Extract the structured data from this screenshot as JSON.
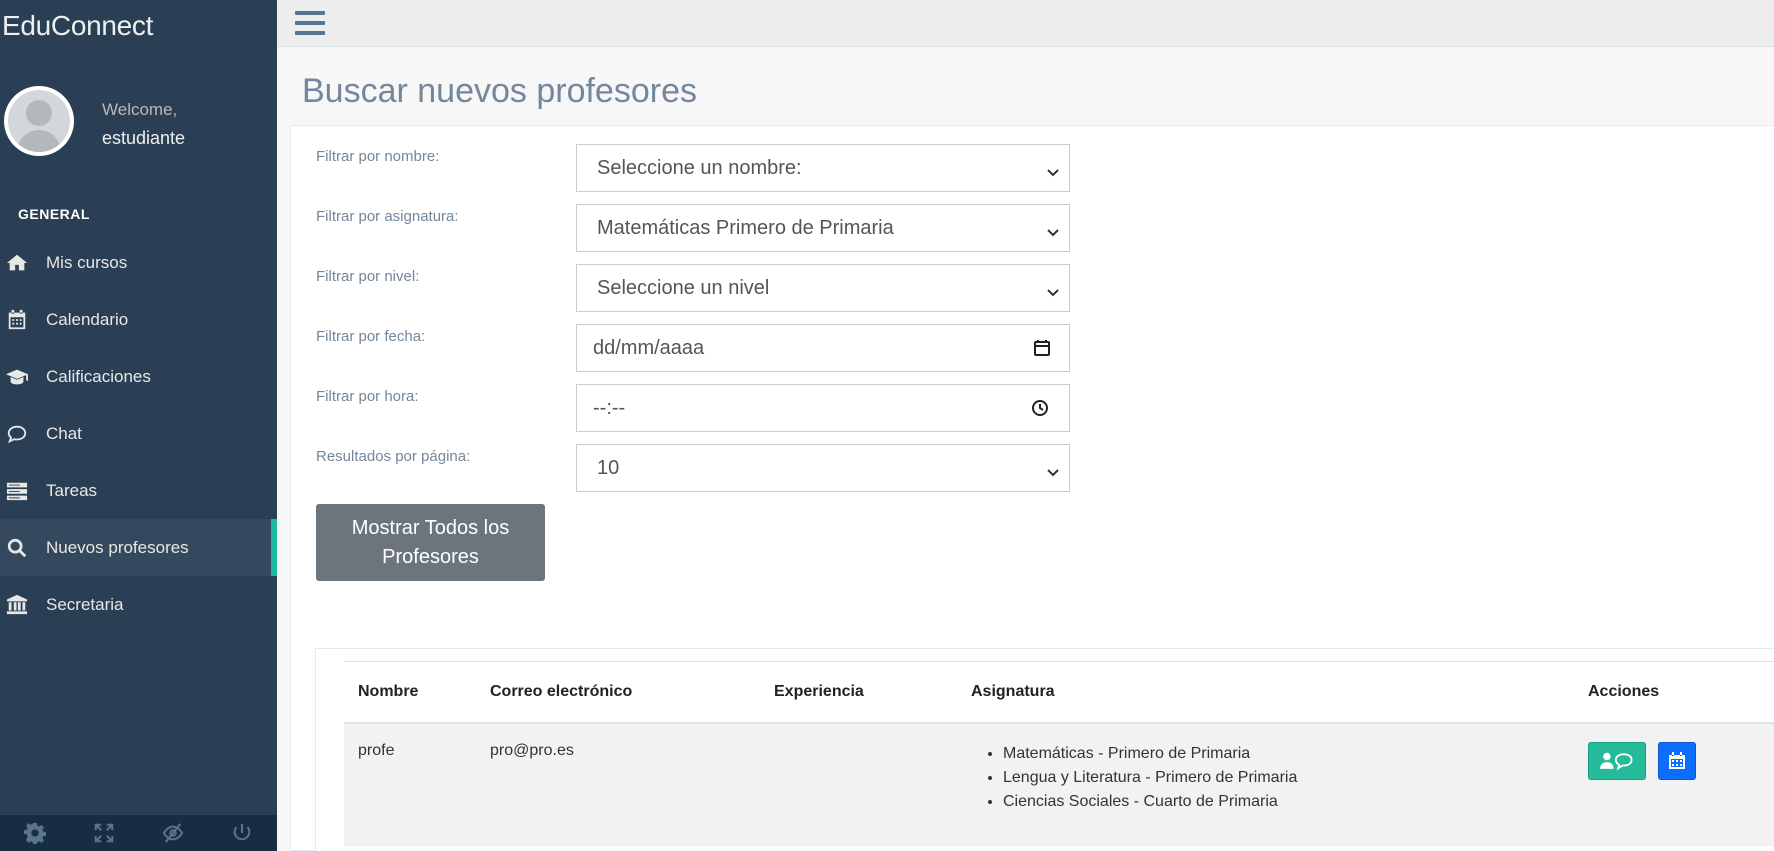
{
  "brand": "EduConnect",
  "profile": {
    "welcome": "Welcome,",
    "username": "estudiante"
  },
  "sidebar": {
    "section": "GENERAL",
    "items": [
      {
        "label": "Mis cursos",
        "icon": "home-icon"
      },
      {
        "label": "Calendario",
        "icon": "calendar-icon"
      },
      {
        "label": "Calificaciones",
        "icon": "graduation-cap-icon"
      },
      {
        "label": "Chat",
        "icon": "chat-bubble-icon"
      },
      {
        "label": "Tareas",
        "icon": "tasks-icon"
      },
      {
        "label": "Nuevos profesores",
        "icon": "search-icon",
        "active": true
      },
      {
        "label": "Secretaria",
        "icon": "bank-icon"
      }
    ],
    "footer_icons": [
      "gear-icon",
      "fullscreen-icon",
      "eye-slash-icon",
      "power-icon"
    ]
  },
  "colors": {
    "sidebar": "#2a3f54",
    "accent": "#1abb9c",
    "btn_green": "#26b99a",
    "btn_blue": "#0d6efd"
  },
  "page": {
    "title": "Buscar nuevos profesores"
  },
  "filters": {
    "name_label": "Filtrar por nombre:",
    "name_value": "Seleccione un nombre:",
    "subject_label": "Filtrar por asignatura:",
    "subject_value": "Matemáticas Primero de Primaria",
    "level_label": "Filtrar por nivel:",
    "level_value": "Seleccione un nivel",
    "date_label": "Filtrar por fecha:",
    "date_value": "dd/mm/aaaa",
    "time_label": "Filtrar por hora:",
    "time_value": "--:--",
    "perpage_label": "Resultados por página:",
    "perpage_value": "10"
  },
  "show_all_button": "Mostrar Todos los Profesores",
  "table": {
    "headers": [
      "Nombre",
      "Correo electrónico",
      "Experiencia",
      "Asignatura",
      "Acciones"
    ],
    "rows": [
      {
        "name": "profe",
        "email": "pro@pro.es",
        "experience": "",
        "subjects": [
          "Matemáticas - Primero de Primaria",
          "Lengua y Literatura - Primero de Primaria",
          "Ciencias Sociales - Cuarto de Primaria"
        ]
      }
    ]
  }
}
